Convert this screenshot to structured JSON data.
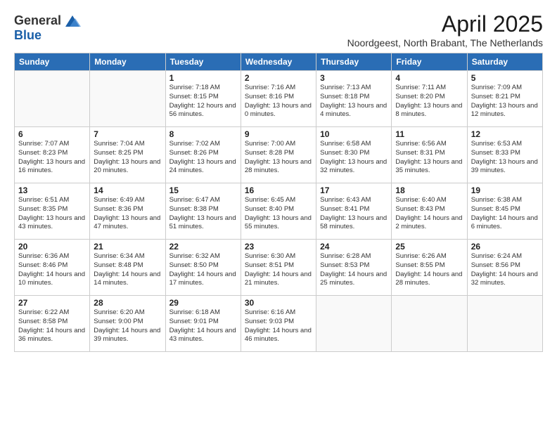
{
  "logo": {
    "general": "General",
    "blue": "Blue"
  },
  "title": "April 2025",
  "subtitle": "Noordgeest, North Brabant, The Netherlands",
  "days_of_week": [
    "Sunday",
    "Monday",
    "Tuesday",
    "Wednesday",
    "Thursday",
    "Friday",
    "Saturday"
  ],
  "weeks": [
    [
      {
        "day": "",
        "info": ""
      },
      {
        "day": "",
        "info": ""
      },
      {
        "day": "1",
        "info": "Sunrise: 7:18 AM\nSunset: 8:15 PM\nDaylight: 12 hours and 56 minutes."
      },
      {
        "day": "2",
        "info": "Sunrise: 7:16 AM\nSunset: 8:16 PM\nDaylight: 13 hours and 0 minutes."
      },
      {
        "day": "3",
        "info": "Sunrise: 7:13 AM\nSunset: 8:18 PM\nDaylight: 13 hours and 4 minutes."
      },
      {
        "day": "4",
        "info": "Sunrise: 7:11 AM\nSunset: 8:20 PM\nDaylight: 13 hours and 8 minutes."
      },
      {
        "day": "5",
        "info": "Sunrise: 7:09 AM\nSunset: 8:21 PM\nDaylight: 13 hours and 12 minutes."
      }
    ],
    [
      {
        "day": "6",
        "info": "Sunrise: 7:07 AM\nSunset: 8:23 PM\nDaylight: 13 hours and 16 minutes."
      },
      {
        "day": "7",
        "info": "Sunrise: 7:04 AM\nSunset: 8:25 PM\nDaylight: 13 hours and 20 minutes."
      },
      {
        "day": "8",
        "info": "Sunrise: 7:02 AM\nSunset: 8:26 PM\nDaylight: 13 hours and 24 minutes."
      },
      {
        "day": "9",
        "info": "Sunrise: 7:00 AM\nSunset: 8:28 PM\nDaylight: 13 hours and 28 minutes."
      },
      {
        "day": "10",
        "info": "Sunrise: 6:58 AM\nSunset: 8:30 PM\nDaylight: 13 hours and 32 minutes."
      },
      {
        "day": "11",
        "info": "Sunrise: 6:56 AM\nSunset: 8:31 PM\nDaylight: 13 hours and 35 minutes."
      },
      {
        "day": "12",
        "info": "Sunrise: 6:53 AM\nSunset: 8:33 PM\nDaylight: 13 hours and 39 minutes."
      }
    ],
    [
      {
        "day": "13",
        "info": "Sunrise: 6:51 AM\nSunset: 8:35 PM\nDaylight: 13 hours and 43 minutes."
      },
      {
        "day": "14",
        "info": "Sunrise: 6:49 AM\nSunset: 8:36 PM\nDaylight: 13 hours and 47 minutes."
      },
      {
        "day": "15",
        "info": "Sunrise: 6:47 AM\nSunset: 8:38 PM\nDaylight: 13 hours and 51 minutes."
      },
      {
        "day": "16",
        "info": "Sunrise: 6:45 AM\nSunset: 8:40 PM\nDaylight: 13 hours and 55 minutes."
      },
      {
        "day": "17",
        "info": "Sunrise: 6:43 AM\nSunset: 8:41 PM\nDaylight: 13 hours and 58 minutes."
      },
      {
        "day": "18",
        "info": "Sunrise: 6:40 AM\nSunset: 8:43 PM\nDaylight: 14 hours and 2 minutes."
      },
      {
        "day": "19",
        "info": "Sunrise: 6:38 AM\nSunset: 8:45 PM\nDaylight: 14 hours and 6 minutes."
      }
    ],
    [
      {
        "day": "20",
        "info": "Sunrise: 6:36 AM\nSunset: 8:46 PM\nDaylight: 14 hours and 10 minutes."
      },
      {
        "day": "21",
        "info": "Sunrise: 6:34 AM\nSunset: 8:48 PM\nDaylight: 14 hours and 14 minutes."
      },
      {
        "day": "22",
        "info": "Sunrise: 6:32 AM\nSunset: 8:50 PM\nDaylight: 14 hours and 17 minutes."
      },
      {
        "day": "23",
        "info": "Sunrise: 6:30 AM\nSunset: 8:51 PM\nDaylight: 14 hours and 21 minutes."
      },
      {
        "day": "24",
        "info": "Sunrise: 6:28 AM\nSunset: 8:53 PM\nDaylight: 14 hours and 25 minutes."
      },
      {
        "day": "25",
        "info": "Sunrise: 6:26 AM\nSunset: 8:55 PM\nDaylight: 14 hours and 28 minutes."
      },
      {
        "day": "26",
        "info": "Sunrise: 6:24 AM\nSunset: 8:56 PM\nDaylight: 14 hours and 32 minutes."
      }
    ],
    [
      {
        "day": "27",
        "info": "Sunrise: 6:22 AM\nSunset: 8:58 PM\nDaylight: 14 hours and 36 minutes."
      },
      {
        "day": "28",
        "info": "Sunrise: 6:20 AM\nSunset: 9:00 PM\nDaylight: 14 hours and 39 minutes."
      },
      {
        "day": "29",
        "info": "Sunrise: 6:18 AM\nSunset: 9:01 PM\nDaylight: 14 hours and 43 minutes."
      },
      {
        "day": "30",
        "info": "Sunrise: 6:16 AM\nSunset: 9:03 PM\nDaylight: 14 hours and 46 minutes."
      },
      {
        "day": "",
        "info": ""
      },
      {
        "day": "",
        "info": ""
      },
      {
        "day": "",
        "info": ""
      }
    ]
  ]
}
